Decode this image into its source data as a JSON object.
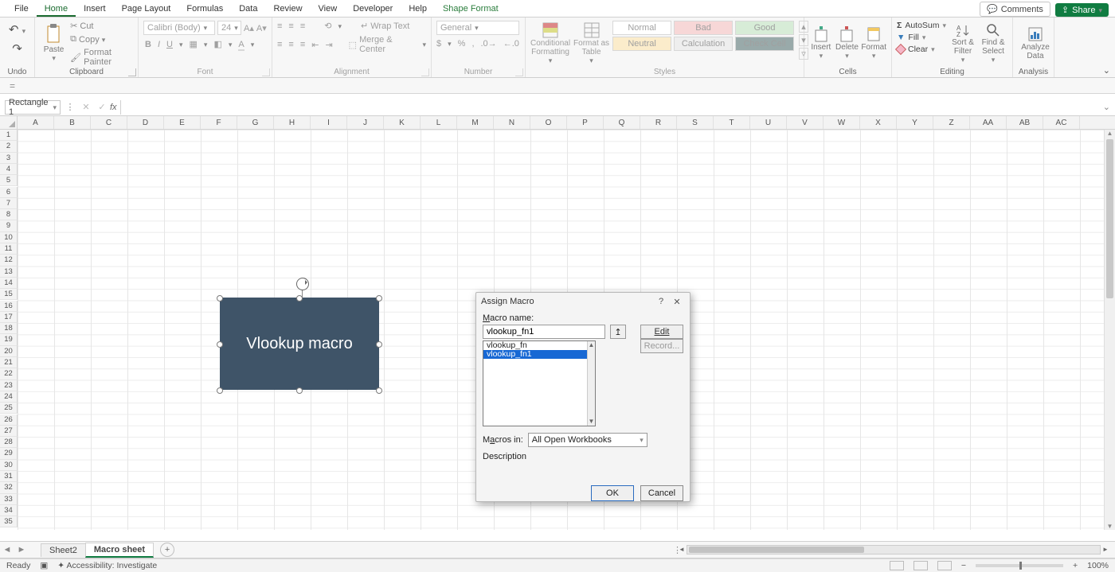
{
  "menu": {
    "items": [
      "File",
      "Home",
      "Insert",
      "Page Layout",
      "Formulas",
      "Data",
      "Review",
      "View",
      "Developer",
      "Help",
      "Shape Format"
    ],
    "active": "Home"
  },
  "topRight": {
    "comments": "Comments",
    "share": "Share"
  },
  "ribbon": {
    "undo": {
      "label": "Undo"
    },
    "clipboard": {
      "label": "Clipboard",
      "paste": "Paste",
      "cut": "Cut",
      "copy": "Copy",
      "formatPainter": "Format Painter"
    },
    "font": {
      "label": "Font",
      "fontName": "Calibri (Body)",
      "fontSize": "24"
    },
    "alignment": {
      "label": "Alignment",
      "wrap": "Wrap Text",
      "merge": "Merge & Center"
    },
    "number": {
      "label": "Number",
      "format": "General"
    },
    "styles": {
      "label": "Styles",
      "conditional": "Conditional\nFormatting",
      "formatAs": "Format as\nTable",
      "cells": [
        "Normal",
        "Bad",
        "Good",
        "Neutral",
        "Calculation",
        "Check Cell"
      ]
    },
    "cellsGroup": {
      "label": "Cells",
      "insert": "Insert",
      "delete": "Delete",
      "format": "Format"
    },
    "editing": {
      "label": "Editing",
      "autosum": "AutoSum",
      "fill": "Fill",
      "clear": "Clear",
      "sort": "Sort &\nFilter",
      "find": "Find &\nSelect"
    },
    "analysis": {
      "label": "Analysis",
      "analyze": "Analyze\nData"
    }
  },
  "formulaBar": {
    "nameBox": "Rectangle 1",
    "fx": "fx",
    "formula": ""
  },
  "grid": {
    "columns": [
      "A",
      "B",
      "C",
      "D",
      "E",
      "F",
      "G",
      "H",
      "I",
      "J",
      "K",
      "L",
      "M",
      "N",
      "O",
      "P",
      "Q",
      "R",
      "S",
      "T",
      "U",
      "V",
      "W",
      "X",
      "Y",
      "Z",
      "AA",
      "AB",
      "AC"
    ],
    "rowStart": 1,
    "rowEnd": 35
  },
  "shape": {
    "text": "Vlookup macro"
  },
  "dialog": {
    "title": "Assign Macro",
    "nameLabel": "Macro name:",
    "nameValue": "vlookup_fn1",
    "listItems": [
      "vlookup_fn",
      "vlookup_fn1"
    ],
    "selected": "vlookup_fn1",
    "macrosInLabel": "Macros in:",
    "macrosInValue": "All Open Workbooks",
    "descriptionLabel": "Description",
    "buttons": {
      "edit": "Edit",
      "record": "Record...",
      "ok": "OK",
      "cancel": "Cancel"
    }
  },
  "sheetTabs": {
    "tabs": [
      "Sheet2",
      "Macro sheet"
    ],
    "active": "Macro sheet"
  },
  "status": {
    "ready": "Ready",
    "accessibility": "Accessibility: Investigate",
    "zoom": "100%"
  }
}
